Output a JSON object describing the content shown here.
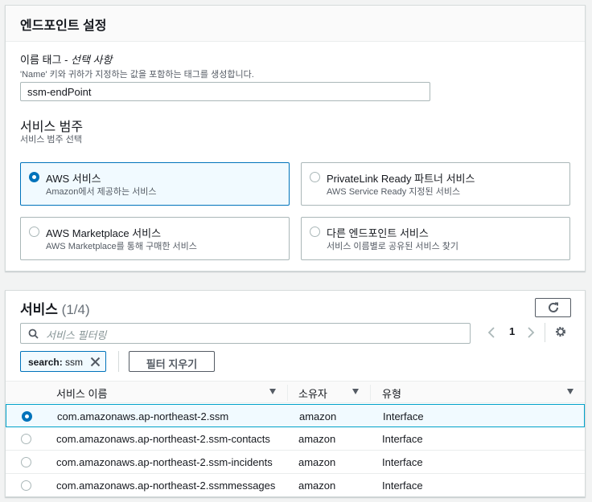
{
  "endpoint_settings": {
    "title": "엔드포인트 설정",
    "name_tag": {
      "label": "이름 태그 - ",
      "label_optional": "선택 사항",
      "description": "'Name' 키와 귀하가 지정하는 값을 포함하는 태그를 생성합니다.",
      "value": "ssm-endPoint"
    },
    "service_category": {
      "label": "서비스 범주",
      "description": "서비스 범주 선택",
      "options": [
        {
          "title": "AWS 서비스",
          "desc": "Amazon에서 제공하는 서비스",
          "selected": true
        },
        {
          "title": "PrivateLink Ready 파트너 서비스",
          "desc": "AWS Service Ready 지정된 서비스",
          "selected": false
        },
        {
          "title": "AWS Marketplace 서비스",
          "desc": "AWS Marketplace를 통해 구매한 서비스",
          "selected": false
        },
        {
          "title": "다른 엔드포인트 서비스",
          "desc": "서비스 이름별로 공유된 서비스 찾기",
          "selected": false
        }
      ]
    }
  },
  "services": {
    "title": "서비스",
    "count": "(1/4)",
    "filter_placeholder": "서비스 필터링",
    "page_number": "1",
    "filter_token": {
      "key": "search:",
      "value": "ssm"
    },
    "clear_filters_label": "필터 지우기",
    "columns": [
      "서비스 이름",
      "소유자",
      "유형"
    ],
    "rows": [
      {
        "name": "com.amazonaws.ap-northeast-2.ssm",
        "owner": "amazon",
        "type": "Interface",
        "selected": true
      },
      {
        "name": "com.amazonaws.ap-northeast-2.ssm-contacts",
        "owner": "amazon",
        "type": "Interface",
        "selected": false
      },
      {
        "name": "com.amazonaws.ap-northeast-2.ssm-incidents",
        "owner": "amazon",
        "type": "Interface",
        "selected": false
      },
      {
        "name": "com.amazonaws.ap-northeast-2.ssmmessages",
        "owner": "amazon",
        "type": "Interface",
        "selected": false
      }
    ]
  },
  "colors": {
    "accent": "#0073bb",
    "selected_bg": "#f1faff",
    "border": "#aab7b8"
  },
  "icons": [
    "refresh-icon",
    "search-icon",
    "chevron-left-icon",
    "chevron-right-icon",
    "gear-icon",
    "close-icon",
    "sort-caret-icon"
  ]
}
